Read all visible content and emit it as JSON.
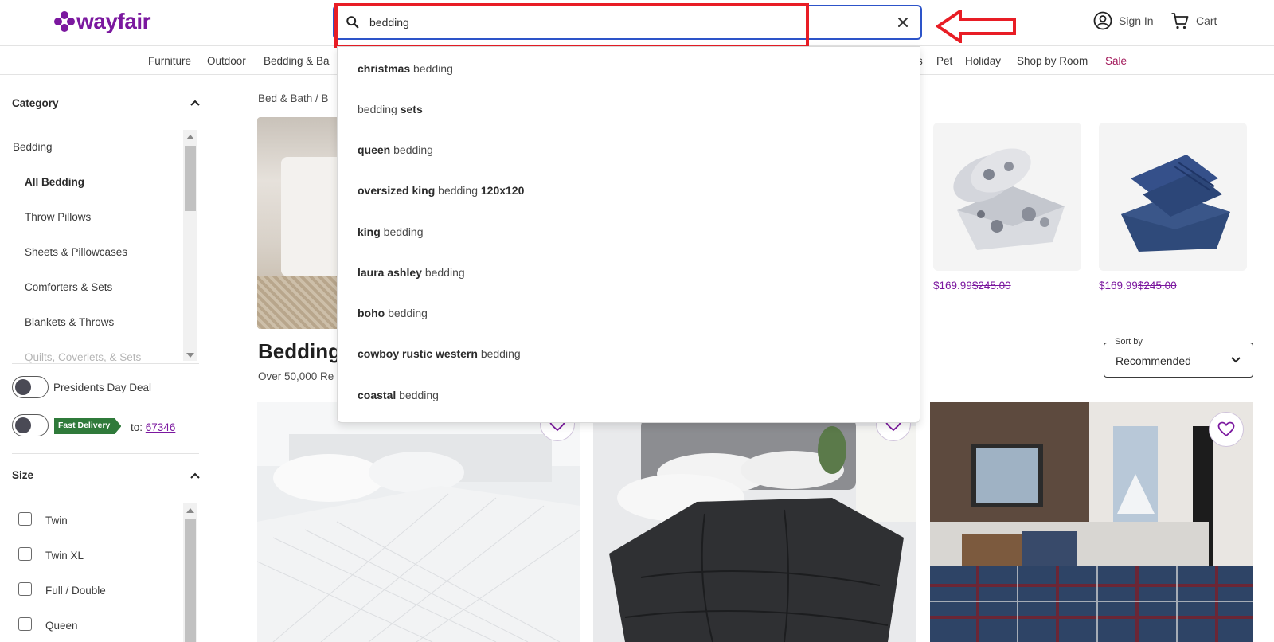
{
  "brand": {
    "name": "wayfair",
    "color": "#7b189f"
  },
  "search": {
    "value": "bedding",
    "clear_icon": "close-icon",
    "icon": "search-icon"
  },
  "account": {
    "sign_in": "Sign In",
    "cart": "Cart"
  },
  "nav": {
    "items": [
      "Furniture",
      "Outdoor",
      "Bedding & Ba",
      "s",
      "Pet",
      "Holiday",
      "Shop by Room"
    ],
    "sale": "Sale"
  },
  "suggestions": [
    {
      "bold": "christmas",
      "rest": " bedding"
    },
    {
      "pre": "bedding ",
      "bold": "sets"
    },
    {
      "bold": "queen",
      "rest": " bedding"
    },
    {
      "bold": "oversized king",
      "rest": " bedding ",
      "bold2": "120x120"
    },
    {
      "bold": "king",
      "rest": " bedding"
    },
    {
      "bold": "laura ashley",
      "rest": " bedding"
    },
    {
      "bold": "boho",
      "rest": " bedding"
    },
    {
      "bold": "cowboy rustic western",
      "rest": " bedding"
    },
    {
      "bold": "coastal",
      "rest": " bedding"
    }
  ],
  "sidebar": {
    "category_title": "Category",
    "category_items": [
      "Bedding",
      "All Bedding",
      "Throw Pillows",
      "Sheets & Pillowcases",
      "Comforters & Sets",
      "Blankets & Throws",
      "Quilts, Coverlets, & Sets"
    ],
    "presidents_day": "Presidents Day Deal",
    "fast_delivery_badge": "Fast Delivery",
    "delivery_to": "to:",
    "zip": "67346",
    "size_title": "Size",
    "sizes": [
      "Twin",
      "Twin XL",
      "Full / Double",
      "Queen"
    ]
  },
  "main": {
    "breadcrumb": "Bed & Bath  /  B",
    "title": "Bedding",
    "result_count": "Over 50,000 Re",
    "mini_products": [
      {
        "price": "$169.99",
        "old_price": "$245.00"
      },
      {
        "price": "$169.99",
        "old_price": "$245.00"
      }
    ],
    "sort_label": "Sort by",
    "sort_value": "Recommended"
  },
  "colors": {
    "search_border": "#2d54c9",
    "highlight": "#e81d25",
    "sale": "#a2195a",
    "badge_green": "#2f7a3a"
  }
}
